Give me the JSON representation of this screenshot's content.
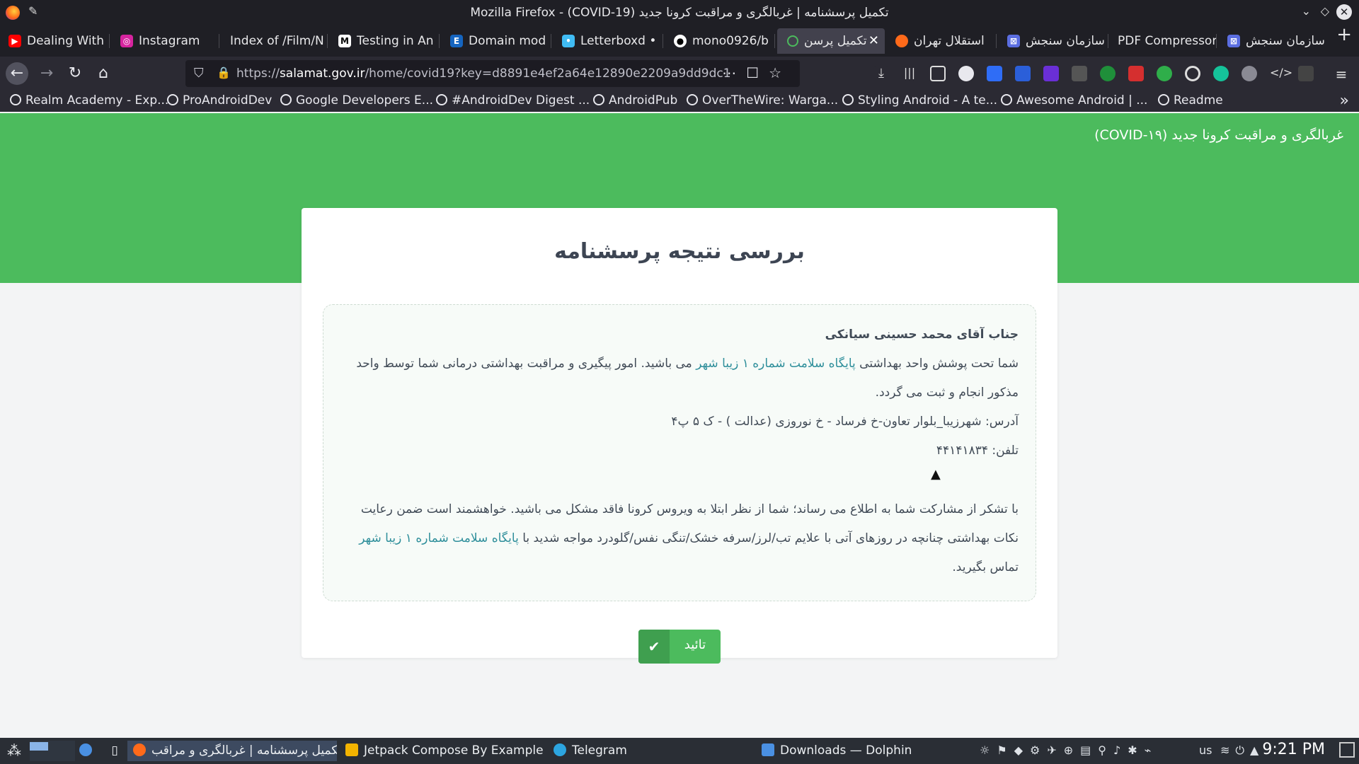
{
  "window": {
    "title": "Mozilla Firefox - (COVID-19) تکمیل پرسشنامه | غربالگری و مراقبت کرونا جدید"
  },
  "tabs": [
    {
      "label": "Dealing With",
      "icon": "youtube-icon",
      "color": "#ff0000"
    },
    {
      "label": "Instagram",
      "icon": "instagram-icon",
      "color": "#d6249f"
    },
    {
      "label": "Index of /Film/N",
      "icon": "folder-icon",
      "color": "#1f1f25"
    },
    {
      "label": "Testing in An",
      "icon": "medium-icon",
      "color": "#000000"
    },
    {
      "label": "Domain mod",
      "icon": "ec-icon",
      "color": "#1565c0"
    },
    {
      "label": "Letterboxd •",
      "icon": "letterboxd-icon",
      "color": "#40bcf4"
    },
    {
      "label": "mono0926/b",
      "icon": "github-icon",
      "color": "#000000"
    },
    {
      "label": "تکمیل پرسن",
      "icon": "loading-icon",
      "color": "#4cbb5d",
      "active": true
    },
    {
      "label": "استقلال تهران",
      "icon": "esteghlal-icon",
      "color": "#ff6a1a"
    },
    {
      "label": "سازمان سنجش",
      "icon": "sanjesh-icon",
      "color": "#5b6ee1"
    },
    {
      "label": "PDF Compressor",
      "icon": "pdf-icon",
      "color": "#1f1f25"
    },
    {
      "label": "سازمان سنجش",
      "icon": "sanjesh-icon",
      "color": "#5b6ee1"
    }
  ],
  "navbar": {
    "url_prefix": "https://",
    "url_domain": "salamat.gov.ir",
    "url_rest": "/home/covid19?key=d8891e4ef2a64e12890e2209a9dd9dc1"
  },
  "bookmarks": [
    "Realm Academy - Exp...",
    "ProAndroidDev",
    "Google Developers E...",
    "#AndroidDev Digest ...",
    "AndroidPub",
    "OverTheWire: Warga...",
    "Styling Android - A te...",
    "Awesome Android | ...",
    "Readme"
  ],
  "site": {
    "header_title": "غربالگری و مراقبت کرونا جدید (COVID-۱۹)",
    "card_title": "بررسی نتیجه پرسشنامه",
    "greeting": "جناب آقای محمد حسینی سیانکی",
    "coverage_part1": "شما تحت پوشش واحد بهداشتی ",
    "facility": "پایگاه سلامت شماره ۱ زیبا شهر",
    "coverage_part2": " می باشید. امور پیگیری و مراقبت بهداشتی درمانی شما توسط واحد مذکور انجام و ثبت می گردد.",
    "address": "آدرس: شهرزیبا_بلوار تعاون-خ فرساد - خ نوروزی (عدالت ) - ک ۵ پ۴",
    "phone": "تلفن: ۴۴۱۴۱۸۳۴",
    "result_part1": "با تشکر از مشارکت شما به اطلاع می رساند؛ شما از نظر ابتلا به ویروس کرونا فاقد مشکل می باشید. خواهشمند است ضمن رعایت نکات بهداشتی چنانچه در روزهای آتی با علایم تب/لرز/سرفه خشک/تنگی نفس/گلودرد مواجه شدید با ",
    "result_part2": " تماس بگیرید.",
    "confirm_label": "تائید"
  },
  "taskbar": {
    "items": [
      "تکمیل پرسشنامه | غربالگری و مراقب...",
      "Jetpack Compose By Example ...",
      "Telegram",
      "Downloads — Dolphin"
    ],
    "lang": "us",
    "time": "9:21 PM"
  },
  "colors": {
    "brand_green": "#4cbb5d",
    "link_teal": "#2f8f9b"
  }
}
